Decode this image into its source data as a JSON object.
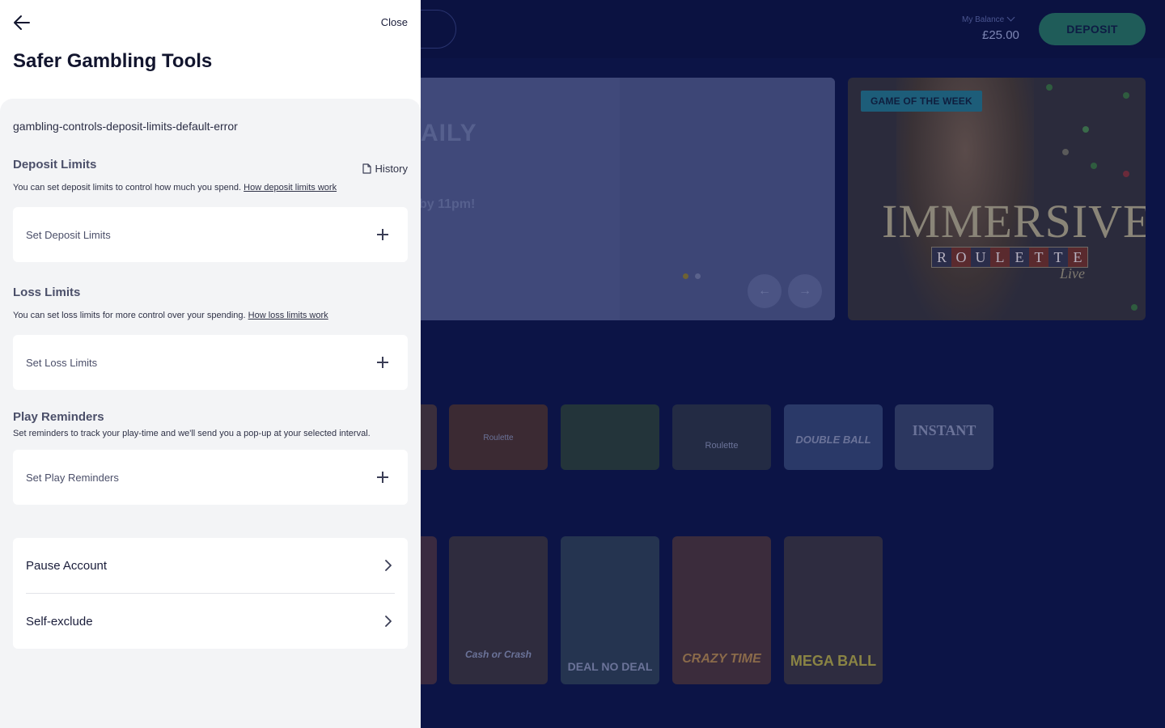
{
  "background": {
    "balance_label": "My Balance",
    "balance_amount": "£25.00",
    "deposit_label": "DEPOSIT",
    "hero_title": "AILY",
    "hero_sub": "by 11pm!",
    "game_of_week_badge": "GAME OF THE WEEK",
    "game_of_week_brand": "IMMERSIVE",
    "game_of_week_letters": [
      "R",
      "O",
      "U",
      "L",
      "E",
      "T",
      "T",
      "E"
    ],
    "game_of_week_live": "Live",
    "row1_captions": [
      "",
      "Roulette",
      "",
      "Roulette",
      "DOUBLE BALL",
      "INSTANT"
    ],
    "row2_captions": [
      "",
      "Cash or Crash",
      "DEAL NO DEAL",
      "CRAZY TIME",
      "MEGA BALL"
    ]
  },
  "drawer": {
    "close_label": "Close",
    "title": "Safer Gambling Tools",
    "error_key": "gambling-controls-deposit-limits-default-error",
    "deposit": {
      "title": "Deposit Limits",
      "history_label": "History",
      "description": "You can set deposit limits to control how much you spend.",
      "link": "How deposit limits work",
      "action": "Set Deposit Limits"
    },
    "loss": {
      "title": "Loss Limits",
      "description": "You can set loss limits for more control over your spending.",
      "link": "How loss limits work",
      "action": "Set Loss Limits"
    },
    "reminders": {
      "title": "Play Reminders",
      "description": "Set reminders to track your play-time and we'll send you a pop-up at your selected interval.",
      "action": "Set Play Reminders"
    },
    "nav": [
      {
        "label": "Pause Account"
      },
      {
        "label": "Self-exclude"
      }
    ]
  },
  "colors": {
    "overlay_bg": "#0c1446",
    "drawer_bg": "#f3f4f6",
    "deposit_button": "#1f5c59",
    "badge": "#1d5d79"
  }
}
